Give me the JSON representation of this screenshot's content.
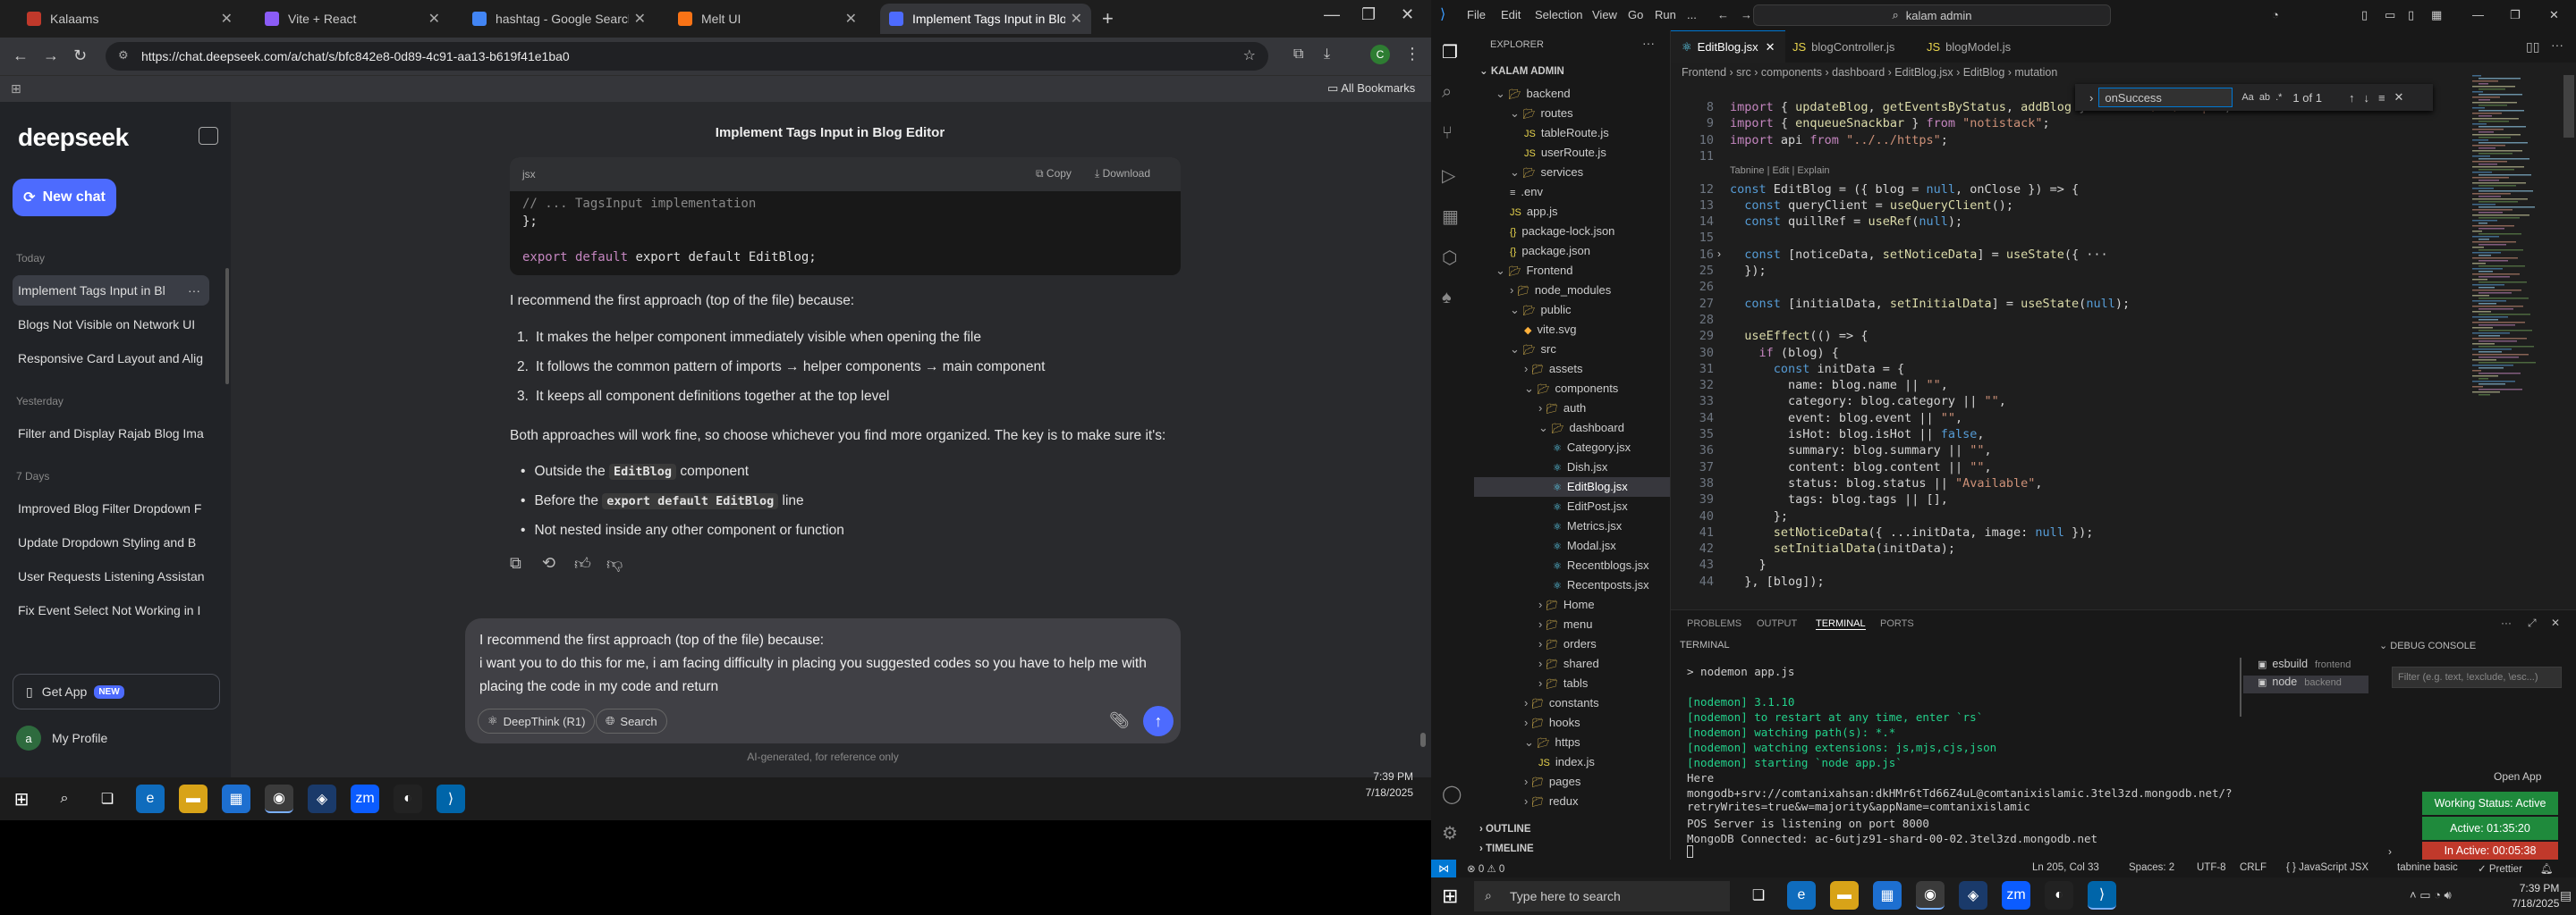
{
  "browser": {
    "tabs": [
      {
        "title": "Kalaams",
        "color": "#c0392b"
      },
      {
        "title": "Vite + React",
        "color": "#8b5cf6"
      },
      {
        "title": "hashtag - Google Search",
        "color": "#4285f4"
      },
      {
        "title": "Melt UI",
        "color": "#f97316"
      },
      {
        "title": "Implement Tags Input in Blog E",
        "color": "#4d6bfe"
      }
    ],
    "url": "https://chat.deepseek.com/a/chat/s/bfc842e8-0d89-4c91-aa13-b619f41e1ba0",
    "bookmarks_label": "All Bookmarks",
    "profile_initial": "C"
  },
  "sidebar": {
    "logo": "deepseek",
    "new_chat": "New chat",
    "groups": [
      {
        "label": "Today",
        "items": [
          "Implement Tags Input in Bl",
          "Blogs Not Visible on Network UI",
          "Responsive Card Layout and Alig"
        ]
      },
      {
        "label": "Yesterday",
        "items": [
          "Filter and Display Rajab Blog Ima"
        ]
      },
      {
        "label": "7 Days",
        "items": [
          "Improved Blog Filter Dropdown F",
          "Update Dropdown Styling and B",
          "User Requests Listening Assistan",
          "Fix Event Select Not Working in I"
        ]
      }
    ],
    "get_app": "Get App",
    "new_badge": "NEW",
    "profile_name": "My Profile",
    "profile_initial": "a"
  },
  "chat": {
    "title": "Implement Tags Input in Blog Editor",
    "code_lang": "jsx",
    "copy": "Copy",
    "download": "Download",
    "code_lines": [
      "// ... TagsInput implementation",
      "};",
      "",
      "export default EditBlog;"
    ],
    "intro": "I recommend the first approach (top of the file) because:",
    "reasons": [
      "It makes the helper component immediately visible when opening the file",
      "It follows the common pattern of imports → helper components → main component",
      "It keeps all component definitions together at the top level"
    ],
    "both": "Both approaches will work fine, so choose whichever you find more organized. The key is to make sure it's:",
    "checks": [
      {
        "pre": "Outside the ",
        "kw": "EditBlog",
        "post": " component"
      },
      {
        "pre": "Before the ",
        "kw": "export default EditBlog",
        "post": " line"
      },
      {
        "pre": "Not nested inside any other component or function",
        "kw": "",
        "post": ""
      }
    ],
    "input_lines": [
      "I recommend the first approach (top of the file) because:",
      "i want you to do this for me, i am facing difficulty in placing you suggested codes so you have to help me with",
      "placing the code in my code and return"
    ],
    "deepthink": "DeepThink (R1)",
    "search": "Search",
    "footer": "AI-generated, for reference only"
  },
  "taskbar_left": {
    "time": "7:39 PM",
    "date": "7/18/2025"
  },
  "vscode": {
    "menu": [
      "File",
      "Edit",
      "Selection",
      "View",
      "Go",
      "Run",
      "..."
    ],
    "command_center": "kalam admin",
    "explorer_title": "EXPLORER",
    "root": "KALAM ADMIN",
    "tree": [
      {
        "label": "backend",
        "depth": 1,
        "type": "open"
      },
      {
        "label": "routes",
        "depth": 2,
        "type": "open"
      },
      {
        "label": "tableRoute.js",
        "depth": 3,
        "type": "js"
      },
      {
        "label": "userRoute.js",
        "depth": 3,
        "type": "js"
      },
      {
        "label": "services",
        "depth": 2,
        "type": "open"
      },
      {
        "label": ".env",
        "depth": 2,
        "type": "file"
      },
      {
        "label": "app.js",
        "depth": 2,
        "type": "js"
      },
      {
        "label": "package-lock.json",
        "depth": 2,
        "type": "json"
      },
      {
        "label": "package.json",
        "depth": 2,
        "type": "json"
      },
      {
        "label": "Frontend",
        "depth": 1,
        "type": "open"
      },
      {
        "label": "node_modules",
        "depth": 2,
        "type": "closed"
      },
      {
        "label": "public",
        "depth": 2,
        "type": "open"
      },
      {
        "label": "vite.svg",
        "depth": 3,
        "type": "svg"
      },
      {
        "label": "src",
        "depth": 2,
        "type": "open"
      },
      {
        "label": "assets",
        "depth": 3,
        "type": "closed"
      },
      {
        "label": "components",
        "depth": 3,
        "type": "open"
      },
      {
        "label": "auth",
        "depth": 4,
        "type": "closed"
      },
      {
        "label": "dashboard",
        "depth": 4,
        "type": "open"
      },
      {
        "label": "Category.jsx",
        "depth": 5,
        "type": "jsx"
      },
      {
        "label": "Dish.jsx",
        "depth": 5,
        "type": "jsx"
      },
      {
        "label": "EditBlog.jsx",
        "depth": 5,
        "type": "jsx",
        "selected": true
      },
      {
        "label": "EditPost.jsx",
        "depth": 5,
        "type": "jsx"
      },
      {
        "label": "Metrics.jsx",
        "depth": 5,
        "type": "jsx"
      },
      {
        "label": "Modal.jsx",
        "depth": 5,
        "type": "jsx"
      },
      {
        "label": "Recentblogs.jsx",
        "depth": 5,
        "type": "jsx"
      },
      {
        "label": "Recentposts.jsx",
        "depth": 5,
        "type": "jsx"
      },
      {
        "label": "Home",
        "depth": 4,
        "type": "closed"
      },
      {
        "label": "menu",
        "depth": 4,
        "type": "closed"
      },
      {
        "label": "orders",
        "depth": 4,
        "type": "closed"
      },
      {
        "label": "shared",
        "depth": 4,
        "type": "closed"
      },
      {
        "label": "tabls",
        "depth": 4,
        "type": "closed"
      },
      {
        "label": "constants",
        "depth": 3,
        "type": "closed"
      },
      {
        "label": "hooks",
        "depth": 3,
        "type": "closed"
      },
      {
        "label": "https",
        "depth": 3,
        "type": "open"
      },
      {
        "label": "index.js",
        "depth": 4,
        "type": "js"
      },
      {
        "label": "pages",
        "depth": 3,
        "type": "closed"
      },
      {
        "label": "redux",
        "depth": 3,
        "type": "closed"
      }
    ],
    "outline": "OUTLINE",
    "timeline": "TIMELINE",
    "tabs": [
      "EditBlog.jsx",
      "blogController.js",
      "blogModel.js"
    ],
    "breadcrumb": "Frontend › src › components › dashboard › EditBlog.jsx › EditBlog › mutation",
    "find_value": "onSuccess",
    "find_count": "1 of 1",
    "code": [
      {
        "n": "8",
        "t": "import { updateBlog, getEventsByStatus, addBlog } from \"../../https\";"
      },
      {
        "n": "9",
        "t": "import { enqueueSnackbar } from \"notistack\";"
      },
      {
        "n": "10",
        "t": "import api from \"../../https\";"
      },
      {
        "n": "11",
        "t": ""
      },
      {
        "n": "",
        "t": "Tabnine | Edit | Explain"
      },
      {
        "n": "12",
        "t": "const EditBlog = ({ blog = null, onClose }) => {"
      },
      {
        "n": "13",
        "t": "  const queryClient = useQueryClient();"
      },
      {
        "n": "14",
        "t": "  const quillRef = useRef(null);"
      },
      {
        "n": "15",
        "t": ""
      },
      {
        "n": "16",
        "t": "  const [noticeData, setNoticeData] = useState({ ···"
      },
      {
        "n": "25",
        "t": "  });"
      },
      {
        "n": "26",
        "t": ""
      },
      {
        "n": "27",
        "t": "  const [initialData, setInitialData] = useState(null);"
      },
      {
        "n": "28",
        "t": ""
      },
      {
        "n": "29",
        "t": "  useEffect(() => {"
      },
      {
        "n": "30",
        "t": "    if (blog) {"
      },
      {
        "n": "31",
        "t": "      const initData = {"
      },
      {
        "n": "32",
        "t": "        name: blog.name || \"\","
      },
      {
        "n": "33",
        "t": "        category: blog.category || \"\","
      },
      {
        "n": "34",
        "t": "        event: blog.event || \"\","
      },
      {
        "n": "35",
        "t": "        isHot: blog.isHot || false,"
      },
      {
        "n": "36",
        "t": "        summary: blog.summary || \"\","
      },
      {
        "n": "37",
        "t": "        content: blog.content || \"\","
      },
      {
        "n": "38",
        "t": "        status: blog.status || \"Available\","
      },
      {
        "n": "39",
        "t": "        tags: blog.tags || [],"
      },
      {
        "n": "40",
        "t": "      };"
      },
      {
        "n": "41",
        "t": "      setNoticeData({ ...initData, image: null });"
      },
      {
        "n": "42",
        "t": "      setInitialData(initData);"
      },
      {
        "n": "43",
        "t": "    }"
      },
      {
        "n": "44",
        "t": "  }, [blog]);"
      }
    ],
    "panel_tabs": [
      "PROBLEMS",
      "OUTPUT",
      "TERMINAL",
      "PORTS"
    ],
    "terminal_title": "TERMINAL",
    "terminal": [
      "> nodemon app.js",
      "",
      "[nodemon] 3.1.10",
      "[nodemon] to restart at any time, enter `rs`",
      "[nodemon] watching path(s): *.*",
      "[nodemon] watching extensions: js,mjs,cjs,json",
      "[nodemon] starting `node app.js`",
      "Here",
      "mongodb+srv://comtanixahsan:dkHMr6tTd66Z4uL@comtanixislamic.3tel3zd.mongodb.net/?retryWrites=true&w=majority&appName=comtanixislamic",
      "POS Server is listening on port 8000",
      "MongoDB Connected: ac-6utjz91-shard-00-02.3tel3zd.mongodb.net"
    ],
    "term_list": [
      {
        "name": "esbuild",
        "dir": "frontend"
      },
      {
        "name": "node",
        "dir": "backend"
      }
    ],
    "debug_title": "DEBUG CONSOLE",
    "debug_filter": "Filter (e.g. text, !exclude, \\esc...)",
    "open_app": "Open App",
    "work_status": "Working Status: Active",
    "active_time": "Active: 01:35:20",
    "inactive_time": "In Active: 00:05:38",
    "status": {
      "errors": "⊗ 0 ⚠ 0",
      "cursor": "Ln 205, Col 33",
      "spaces": "Spaces: 2",
      "encoding": "UTF-8",
      "eol": "CRLF",
      "lang": "{ } JavaScript JSX",
      "tabnine": "tabnine basic",
      "prettier": "✓ Prettier"
    }
  },
  "taskbar_right": {
    "search": "Type here to search",
    "time": "7:39 PM",
    "date": "7/18/2025"
  }
}
